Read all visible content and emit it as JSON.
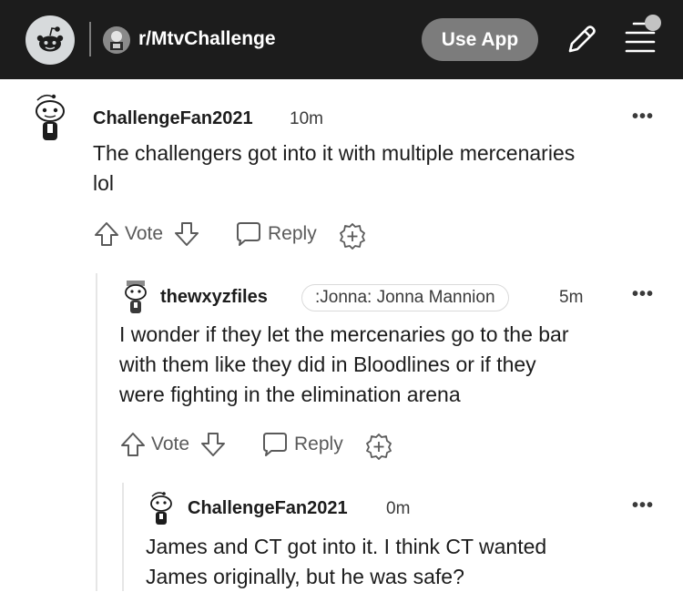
{
  "header": {
    "subreddit": "r/MtvChallenge",
    "use_app_label": "Use App"
  },
  "comments": [
    {
      "author": "ChallengeFan2021",
      "time": "10m",
      "flair": "",
      "body_lines": [
        "The challengers got into it with multiple mercenaries",
        "lol"
      ],
      "vote_label": "Vote",
      "reply_label": "Reply",
      "more": "•••"
    },
    {
      "author": "thewxyzfiles",
      "time": "5m",
      "flair": ":Jonna: Jonna Mannion",
      "body_lines": [
        "I wonder if they let the mercenaries go to the bar",
        "with them like they did in Bloodlines or if they",
        "were fighting in the elimination arena"
      ],
      "vote_label": "Vote",
      "reply_label": "Reply",
      "more": "•••"
    },
    {
      "author": "ChallengeFan2021",
      "time": "0m",
      "flair": "",
      "body_lines": [
        "James and CT got into it. I think CT wanted",
        "James originally, but he was safe?"
      ],
      "more": "•••"
    }
  ],
  "colors": {
    "topbar": "#1c1c1c",
    "button_gray": "#7c7c7c",
    "text": "#1c1c1c",
    "muted": "#5a5a5a"
  }
}
